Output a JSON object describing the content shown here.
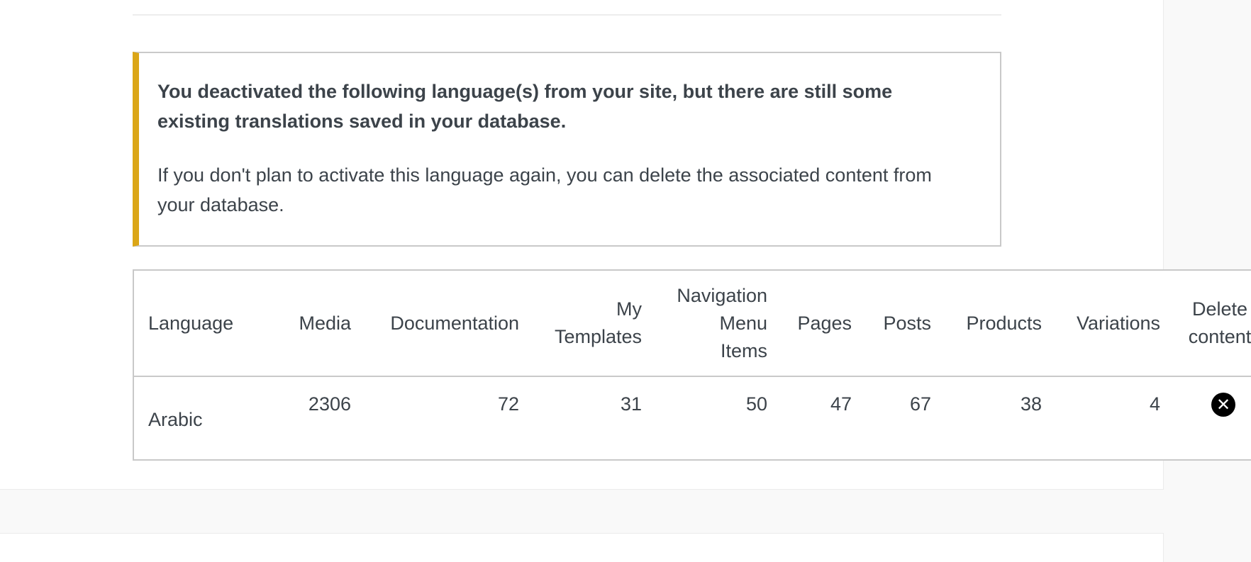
{
  "notice": {
    "title": "You deactivated the following language(s) from your site, but there are still some existing translations saved in your database.",
    "text": "If you don't plan to activate this language again, you can delete the associated content from your database."
  },
  "table": {
    "headers": {
      "language": "Language",
      "media": "Media",
      "documentation": "Documentation",
      "my_templates": [
        "My",
        "Templates"
      ],
      "navigation_menu_items": [
        "Navigation",
        "Menu",
        "Items"
      ],
      "pages": "Pages",
      "posts": "Posts",
      "products": "Products",
      "variations": "Variations",
      "delete_content": [
        "Delete",
        "content"
      ]
    },
    "rows": [
      {
        "language": "Arabic",
        "media": "2306",
        "documentation": "72",
        "my_templates": "31",
        "navigation_menu_items": "50",
        "pages": "47",
        "posts": "67",
        "products": "38",
        "variations": "4",
        "delete_icon": "close-icon"
      }
    ]
  },
  "colors": {
    "notice_accent": "#dba617",
    "delete_button": "#000000"
  }
}
